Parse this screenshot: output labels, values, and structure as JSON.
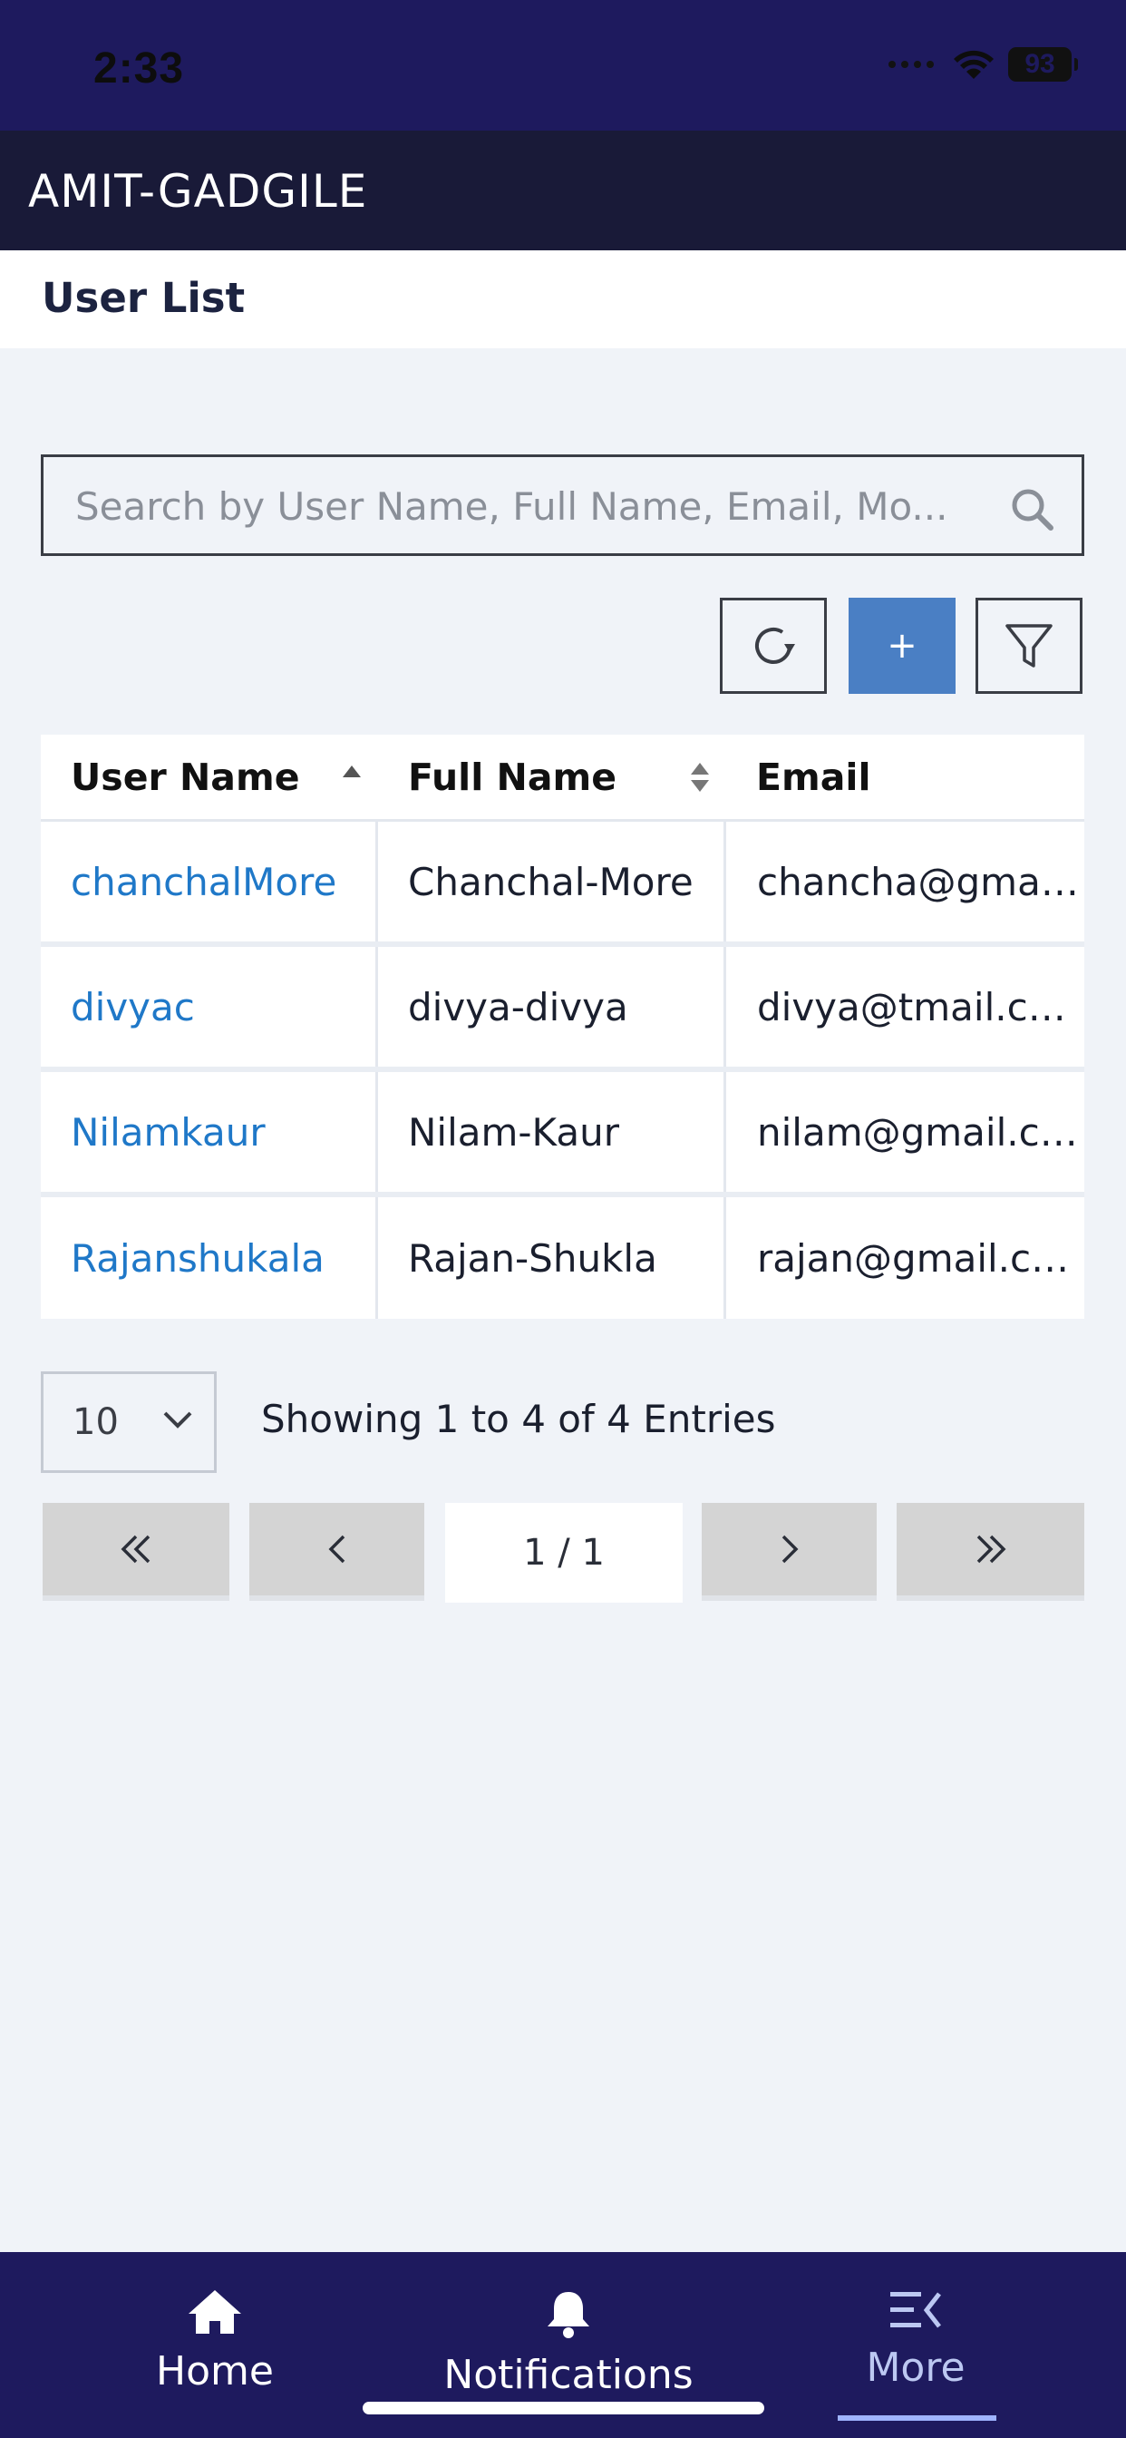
{
  "status_bar": {
    "time": "2:33",
    "battery": "93"
  },
  "header": {
    "app_title": "AMIT-GADGILE"
  },
  "page": {
    "title": "User List"
  },
  "search": {
    "placeholder": "Search by User Name, Full Name, Email, Mo...",
    "value": ""
  },
  "toolbar": {
    "refresh_icon": "refresh-icon",
    "add_label": "+",
    "filter_icon": "filter-icon"
  },
  "table": {
    "columns": [
      "User Name",
      "Full Name",
      "Email"
    ],
    "sort": {
      "user_name": "ascending",
      "full_name": "unsorted"
    },
    "rows": [
      {
        "user_name": "chanchalMore",
        "full_name": "Chanchal-More",
        "email": "chancha@gmail.c.."
      },
      {
        "user_name": "divyac",
        "full_name": "divya-divya",
        "email": "divya@tmail.com"
      },
      {
        "user_name": "Nilamkaur",
        "full_name": "Nilam-Kaur",
        "email": "nilam@gmail.com"
      },
      {
        "user_name": "Rajanshukala",
        "full_name": "Rajan-Shukla",
        "email": "rajan@gmail.com"
      }
    ],
    "link_color": "#1f78c8"
  },
  "pagination": {
    "page_size": "10",
    "entries_text": "Showing 1 to 4 of 4 Entries",
    "page_info": "1 / 1",
    "first_label": "«",
    "prev_label": "‹",
    "next_label": "›",
    "last_label": "»"
  },
  "bottom_nav": {
    "items": [
      {
        "label": "Home",
        "icon": "home-icon"
      },
      {
        "label": "Notifications",
        "icon": "bell-icon"
      },
      {
        "label": "More",
        "icon": "menu-collapse-icon",
        "active": true
      }
    ]
  },
  "colors": {
    "header_bg": "#191a38",
    "status_bg": "#1e1a5e",
    "accent": "#4a7fc4",
    "page_bg": "#f0f3f8"
  }
}
